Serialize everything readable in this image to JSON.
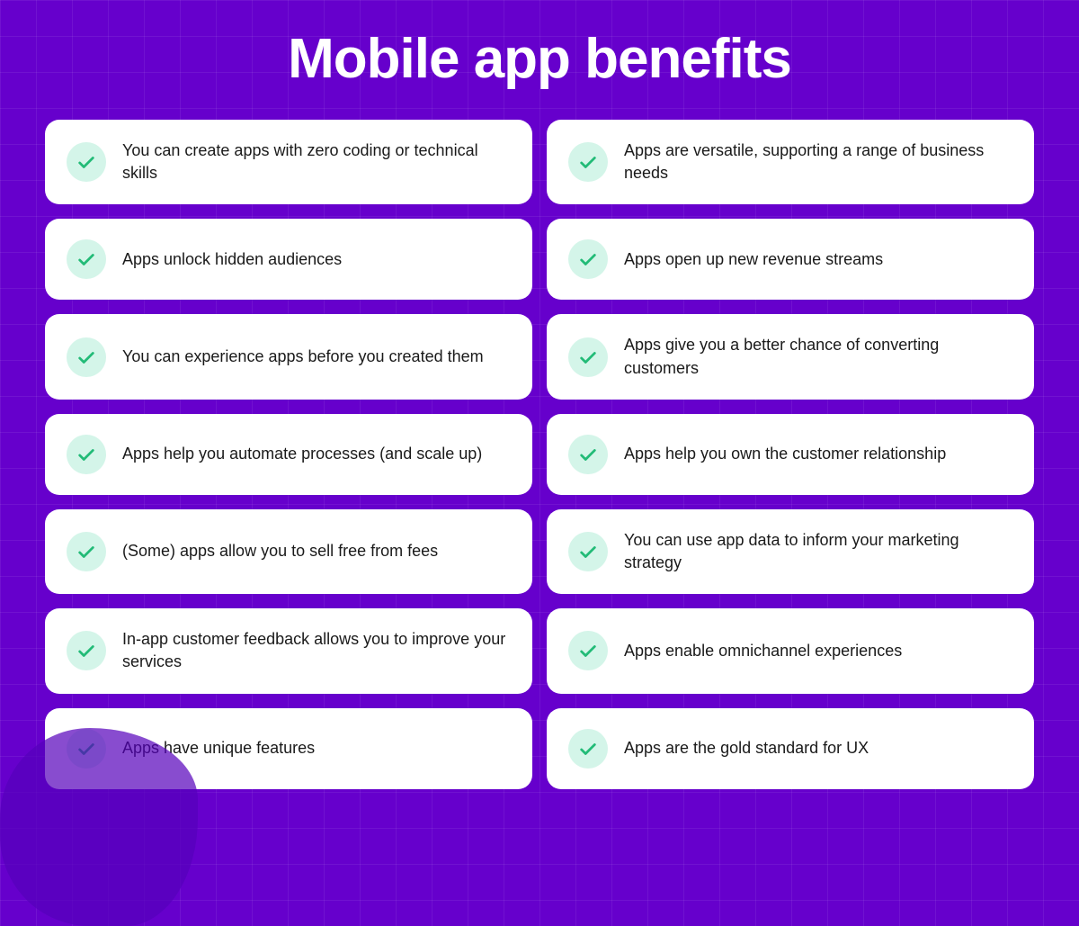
{
  "page": {
    "title": "Mobile app benefits",
    "background_color": "#6600cc"
  },
  "cards": [
    {
      "id": "card-1",
      "text": "You can create apps with zero coding or technical skills"
    },
    {
      "id": "card-2",
      "text": "Apps are versatile, supporting a range of business needs"
    },
    {
      "id": "card-3",
      "text": "Apps unlock hidden audiences"
    },
    {
      "id": "card-4",
      "text": "Apps open up new revenue streams"
    },
    {
      "id": "card-5",
      "text": "You can experience apps before you created them"
    },
    {
      "id": "card-6",
      "text": "Apps give you a better chance of converting customers"
    },
    {
      "id": "card-7",
      "text": "Apps help you automate processes (and scale up)"
    },
    {
      "id": "card-8",
      "text": "Apps help you own the customer relationship"
    },
    {
      "id": "card-9",
      "text": "(Some) apps allow you to sell free from fees"
    },
    {
      "id": "card-10",
      "text": "You can use app data to inform your marketing strategy"
    },
    {
      "id": "card-11",
      "text": "In-app customer feedback allows you to improve your services"
    },
    {
      "id": "card-12",
      "text": "Apps enable omnichannel experiences"
    },
    {
      "id": "card-13",
      "text": "Apps have unique features"
    },
    {
      "id": "card-14",
      "text": "Apps are the gold standard for UX"
    }
  ]
}
